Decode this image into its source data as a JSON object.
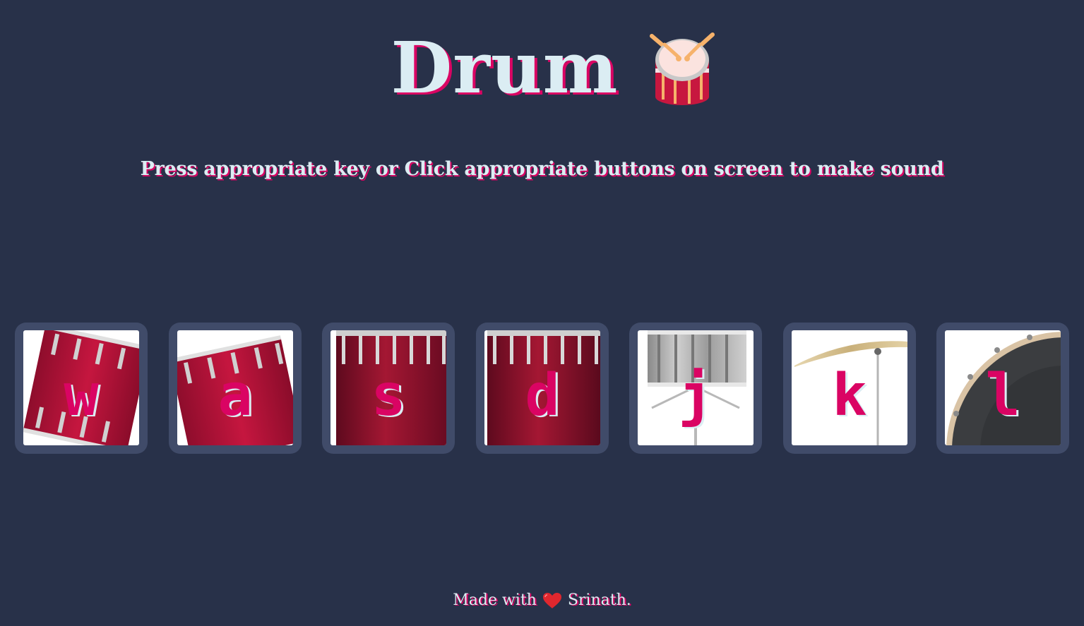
{
  "header": {
    "title": "Drum"
  },
  "subtitle": "Press appropriate key or Click appropriate buttons on screen to make sound",
  "pads": [
    {
      "key": "w",
      "instrument": "tom-tilted"
    },
    {
      "key": "a",
      "instrument": "tom-tilted"
    },
    {
      "key": "s",
      "instrument": "floor-tom"
    },
    {
      "key": "d",
      "instrument": "floor-tom"
    },
    {
      "key": "j",
      "instrument": "snare"
    },
    {
      "key": "k",
      "instrument": "cymbal"
    },
    {
      "key": "l",
      "instrument": "bass-drum"
    }
  ],
  "footer": {
    "made_with": "Made with",
    "author": "Srinath."
  },
  "colors": {
    "background": "#283149",
    "pad_frame": "#404b69",
    "accent": "#da0463",
    "light_text": "#dbedf3"
  }
}
